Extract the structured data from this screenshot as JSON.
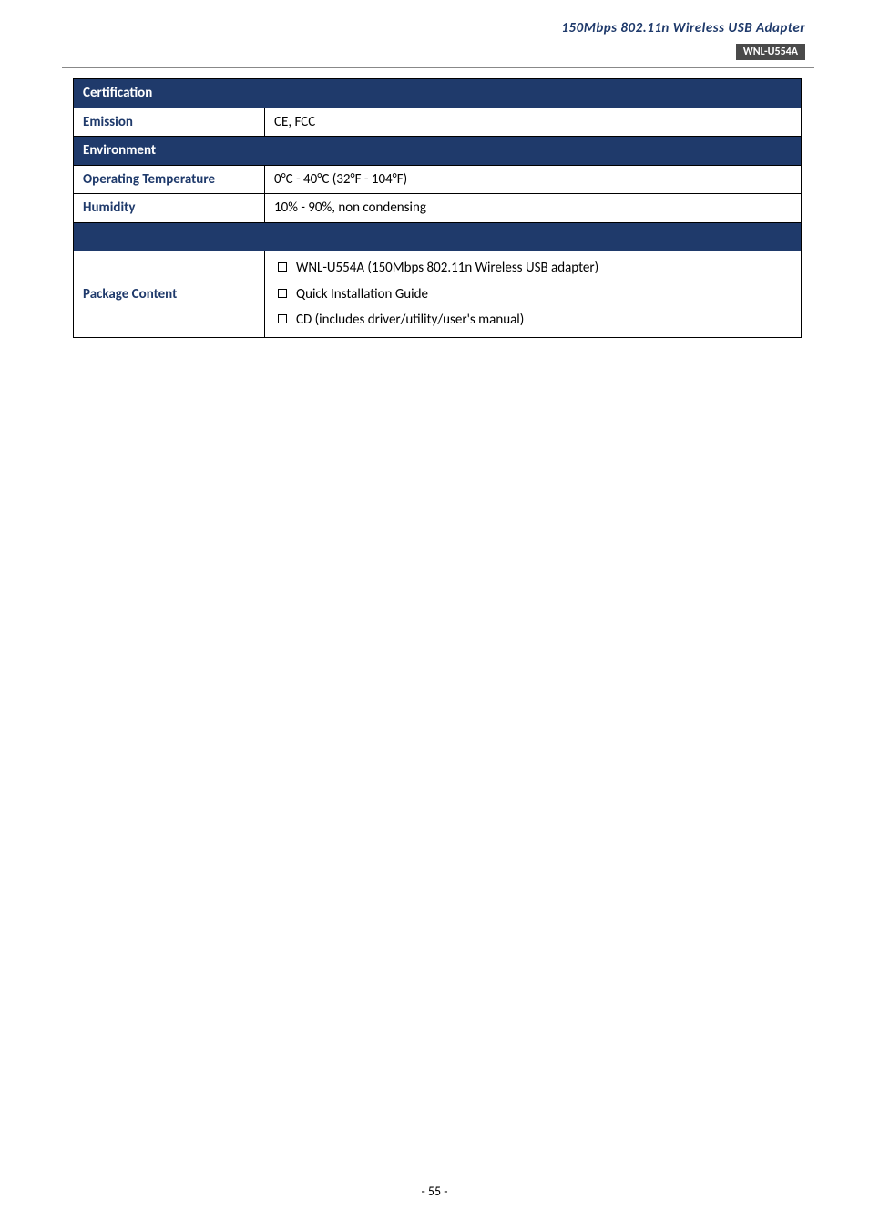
{
  "header": {
    "title": "150Mbps  802.11n  Wireless  USB  Adapter",
    "model": "WNL-U554A"
  },
  "sections": {
    "certification": {
      "header": "Certification",
      "rows": {
        "emission": {
          "label": "Emission",
          "value": "CE, FCC"
        }
      }
    },
    "environment": {
      "header": "Environment",
      "rows": {
        "op_temp": {
          "label": "Operating Temperature",
          "value": "0°C - 40°C (32°F - 104°F)"
        },
        "humidity": {
          "label": "Humidity",
          "value": "10% - 90%, non condensing"
        }
      }
    },
    "package": {
      "label": "Package Content",
      "items": [
        "WNL-U554A (150Mbps 802.11n Wireless USB adapter)",
        "Quick Installation Guide",
        "CD (includes driver/utility/user's manual)"
      ]
    }
  },
  "footer": {
    "page": "- 55 -"
  }
}
